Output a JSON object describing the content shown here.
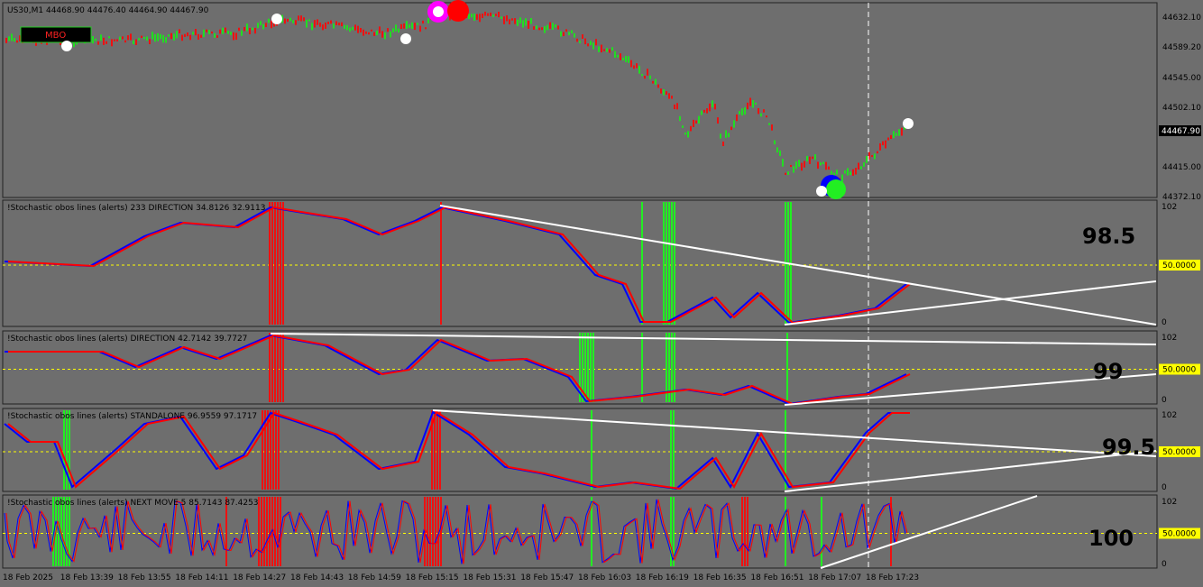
{
  "symbol_header": "US30,M1  44468.90 44476.40 44464.90 44467.90",
  "mbo_label": "MBO",
  "price_axis": [
    "44632.10",
    "44589.20",
    "44545.00",
    "44502.10",
    "44415.00",
    "44372.10"
  ],
  "current_price": "44467.90",
  "panels": [
    {
      "title": "!Stochastic obos lines (alerts) 233 DIRECTION 34.8126 32.9113",
      "level_label": "50.0000",
      "top_label": "102",
      "bottom_label": "0",
      "big_value": "98.5"
    },
    {
      "title": "!Stochastic obos lines (alerts) DIRECTION 42.7142 39.7727",
      "level_label": "50.0000",
      "top_label": "102",
      "bottom_label": "0",
      "big_value": "99"
    },
    {
      "title": "!Stochastic obos lines (alerts) STANDALONE 96.9559 97.1717",
      "level_label": "50.0000",
      "top_label": "102",
      "bottom_label": "0",
      "big_value": "99.5"
    },
    {
      "title": "!Stochastic obos lines (alerts) NEXT MOVE 5 85.7143 87.4253",
      "level_label": "50.0000",
      "top_label": "102",
      "bottom_label": "0",
      "big_value": "100"
    }
  ],
  "time_axis": [
    "18 Feb 2025",
    "18 Feb 13:39",
    "18 Feb 13:55",
    "18 Feb 14:11",
    "18 Feb 14:27",
    "18 Feb 14:43",
    "18 Feb 14:59",
    "18 Feb 15:15",
    "18 Feb 15:31",
    "18 Feb 15:47",
    "18 Feb 16:03",
    "18 Feb 16:19",
    "18 Feb 16:35",
    "18 Feb 16:51",
    "18 Feb 17:07",
    "18 Feb 17:23"
  ],
  "colors": {
    "bg": "#6e6e6e",
    "up": "#22dd22",
    "down": "#ee1111",
    "signal_line": "#0000ff",
    "main_line": "#ff0000",
    "level": "#ffff00",
    "trend": "#ffffff"
  }
}
